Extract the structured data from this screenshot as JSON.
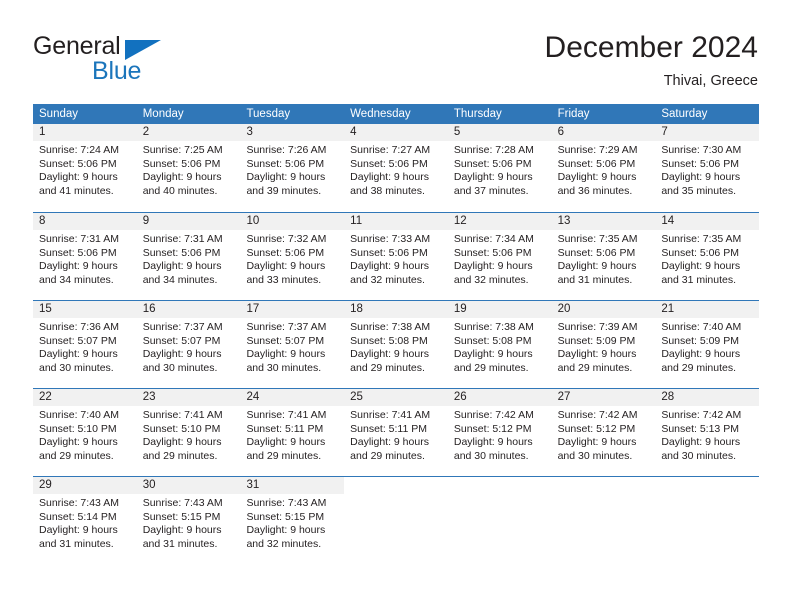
{
  "logo": {
    "word_top": "General",
    "word_bottom": "Blue",
    "triangle_icon": "triangle-icon",
    "color_dark": "#231f20",
    "color_blue": "#1b75bb"
  },
  "header": {
    "title": "December 2024",
    "location": "Thivai, Greece"
  },
  "theme": {
    "header_blue": "#3077b8",
    "day_band": "#f1f1f1",
    "text": "#231f20"
  },
  "weekdays": [
    "Sunday",
    "Monday",
    "Tuesday",
    "Wednesday",
    "Thursday",
    "Friday",
    "Saturday"
  ],
  "weeks": [
    [
      {
        "day": "1",
        "sunrise": "Sunrise: 7:24 AM",
        "sunset": "Sunset: 5:06 PM",
        "daylight1": "Daylight: 9 hours",
        "daylight2": "and 41 minutes."
      },
      {
        "day": "2",
        "sunrise": "Sunrise: 7:25 AM",
        "sunset": "Sunset: 5:06 PM",
        "daylight1": "Daylight: 9 hours",
        "daylight2": "and 40 minutes."
      },
      {
        "day": "3",
        "sunrise": "Sunrise: 7:26 AM",
        "sunset": "Sunset: 5:06 PM",
        "daylight1": "Daylight: 9 hours",
        "daylight2": "and 39 minutes."
      },
      {
        "day": "4",
        "sunrise": "Sunrise: 7:27 AM",
        "sunset": "Sunset: 5:06 PM",
        "daylight1": "Daylight: 9 hours",
        "daylight2": "and 38 minutes."
      },
      {
        "day": "5",
        "sunrise": "Sunrise: 7:28 AM",
        "sunset": "Sunset: 5:06 PM",
        "daylight1": "Daylight: 9 hours",
        "daylight2": "and 37 minutes."
      },
      {
        "day": "6",
        "sunrise": "Sunrise: 7:29 AM",
        "sunset": "Sunset: 5:06 PM",
        "daylight1": "Daylight: 9 hours",
        "daylight2": "and 36 minutes."
      },
      {
        "day": "7",
        "sunrise": "Sunrise: 7:30 AM",
        "sunset": "Sunset: 5:06 PM",
        "daylight1": "Daylight: 9 hours",
        "daylight2": "and 35 minutes."
      }
    ],
    [
      {
        "day": "8",
        "sunrise": "Sunrise: 7:31 AM",
        "sunset": "Sunset: 5:06 PM",
        "daylight1": "Daylight: 9 hours",
        "daylight2": "and 34 minutes."
      },
      {
        "day": "9",
        "sunrise": "Sunrise: 7:31 AM",
        "sunset": "Sunset: 5:06 PM",
        "daylight1": "Daylight: 9 hours",
        "daylight2": "and 34 minutes."
      },
      {
        "day": "10",
        "sunrise": "Sunrise: 7:32 AM",
        "sunset": "Sunset: 5:06 PM",
        "daylight1": "Daylight: 9 hours",
        "daylight2": "and 33 minutes."
      },
      {
        "day": "11",
        "sunrise": "Sunrise: 7:33 AM",
        "sunset": "Sunset: 5:06 PM",
        "daylight1": "Daylight: 9 hours",
        "daylight2": "and 32 minutes."
      },
      {
        "day": "12",
        "sunrise": "Sunrise: 7:34 AM",
        "sunset": "Sunset: 5:06 PM",
        "daylight1": "Daylight: 9 hours",
        "daylight2": "and 32 minutes."
      },
      {
        "day": "13",
        "sunrise": "Sunrise: 7:35 AM",
        "sunset": "Sunset: 5:06 PM",
        "daylight1": "Daylight: 9 hours",
        "daylight2": "and 31 minutes."
      },
      {
        "day": "14",
        "sunrise": "Sunrise: 7:35 AM",
        "sunset": "Sunset: 5:06 PM",
        "daylight1": "Daylight: 9 hours",
        "daylight2": "and 31 minutes."
      }
    ],
    [
      {
        "day": "15",
        "sunrise": "Sunrise: 7:36 AM",
        "sunset": "Sunset: 5:07 PM",
        "daylight1": "Daylight: 9 hours",
        "daylight2": "and 30 minutes."
      },
      {
        "day": "16",
        "sunrise": "Sunrise: 7:37 AM",
        "sunset": "Sunset: 5:07 PM",
        "daylight1": "Daylight: 9 hours",
        "daylight2": "and 30 minutes."
      },
      {
        "day": "17",
        "sunrise": "Sunrise: 7:37 AM",
        "sunset": "Sunset: 5:07 PM",
        "daylight1": "Daylight: 9 hours",
        "daylight2": "and 30 minutes."
      },
      {
        "day": "18",
        "sunrise": "Sunrise: 7:38 AM",
        "sunset": "Sunset: 5:08 PM",
        "daylight1": "Daylight: 9 hours",
        "daylight2": "and 29 minutes."
      },
      {
        "day": "19",
        "sunrise": "Sunrise: 7:38 AM",
        "sunset": "Sunset: 5:08 PM",
        "daylight1": "Daylight: 9 hours",
        "daylight2": "and 29 minutes."
      },
      {
        "day": "20",
        "sunrise": "Sunrise: 7:39 AM",
        "sunset": "Sunset: 5:09 PM",
        "daylight1": "Daylight: 9 hours",
        "daylight2": "and 29 minutes."
      },
      {
        "day": "21",
        "sunrise": "Sunrise: 7:40 AM",
        "sunset": "Sunset: 5:09 PM",
        "daylight1": "Daylight: 9 hours",
        "daylight2": "and 29 minutes."
      }
    ],
    [
      {
        "day": "22",
        "sunrise": "Sunrise: 7:40 AM",
        "sunset": "Sunset: 5:10 PM",
        "daylight1": "Daylight: 9 hours",
        "daylight2": "and 29 minutes."
      },
      {
        "day": "23",
        "sunrise": "Sunrise: 7:41 AM",
        "sunset": "Sunset: 5:10 PM",
        "daylight1": "Daylight: 9 hours",
        "daylight2": "and 29 minutes."
      },
      {
        "day": "24",
        "sunrise": "Sunrise: 7:41 AM",
        "sunset": "Sunset: 5:11 PM",
        "daylight1": "Daylight: 9 hours",
        "daylight2": "and 29 minutes."
      },
      {
        "day": "25",
        "sunrise": "Sunrise: 7:41 AM",
        "sunset": "Sunset: 5:11 PM",
        "daylight1": "Daylight: 9 hours",
        "daylight2": "and 29 minutes."
      },
      {
        "day": "26",
        "sunrise": "Sunrise: 7:42 AM",
        "sunset": "Sunset: 5:12 PM",
        "daylight1": "Daylight: 9 hours",
        "daylight2": "and 30 minutes."
      },
      {
        "day": "27",
        "sunrise": "Sunrise: 7:42 AM",
        "sunset": "Sunset: 5:12 PM",
        "daylight1": "Daylight: 9 hours",
        "daylight2": "and 30 minutes."
      },
      {
        "day": "28",
        "sunrise": "Sunrise: 7:42 AM",
        "sunset": "Sunset: 5:13 PM",
        "daylight1": "Daylight: 9 hours",
        "daylight2": "and 30 minutes."
      }
    ],
    [
      {
        "day": "29",
        "sunrise": "Sunrise: 7:43 AM",
        "sunset": "Sunset: 5:14 PM",
        "daylight1": "Daylight: 9 hours",
        "daylight2": "and 31 minutes."
      },
      {
        "day": "30",
        "sunrise": "Sunrise: 7:43 AM",
        "sunset": "Sunset: 5:15 PM",
        "daylight1": "Daylight: 9 hours",
        "daylight2": "and 31 minutes."
      },
      {
        "day": "31",
        "sunrise": "Sunrise: 7:43 AM",
        "sunset": "Sunset: 5:15 PM",
        "daylight1": "Daylight: 9 hours",
        "daylight2": "and 32 minutes."
      },
      {
        "day": "",
        "sunrise": "",
        "sunset": "",
        "daylight1": "",
        "daylight2": ""
      },
      {
        "day": "",
        "sunrise": "",
        "sunset": "",
        "daylight1": "",
        "daylight2": ""
      },
      {
        "day": "",
        "sunrise": "",
        "sunset": "",
        "daylight1": "",
        "daylight2": ""
      },
      {
        "day": "",
        "sunrise": "",
        "sunset": "",
        "daylight1": "",
        "daylight2": ""
      }
    ]
  ]
}
